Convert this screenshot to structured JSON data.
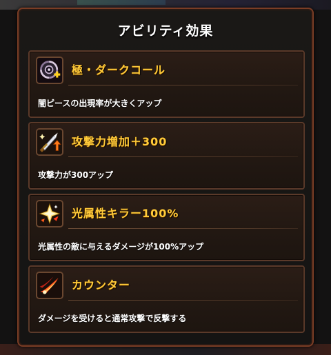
{
  "title": "アビリティ効果",
  "abilities": [
    {
      "name": "極・ダークコール",
      "description": "闇ピースの出現率が大きくアップ",
      "icon": "dark-orb-plus-icon"
    },
    {
      "name": "攻撃力増加＋300",
      "description": "攻撃力が300アップ",
      "icon": "sword-up-icon"
    },
    {
      "name": "光属性キラー100%",
      "description": "光属性の敵に与えるダメージが100%アップ",
      "icon": "light-killer-icon"
    },
    {
      "name": "カウンター",
      "description": "ダメージを受けると通常攻撃で反撃する",
      "icon": "counter-flame-icon"
    }
  ],
  "colors": {
    "name_text": "#ffcb3a",
    "desc_text": "#ffffff",
    "frame": "#7b3d25"
  }
}
